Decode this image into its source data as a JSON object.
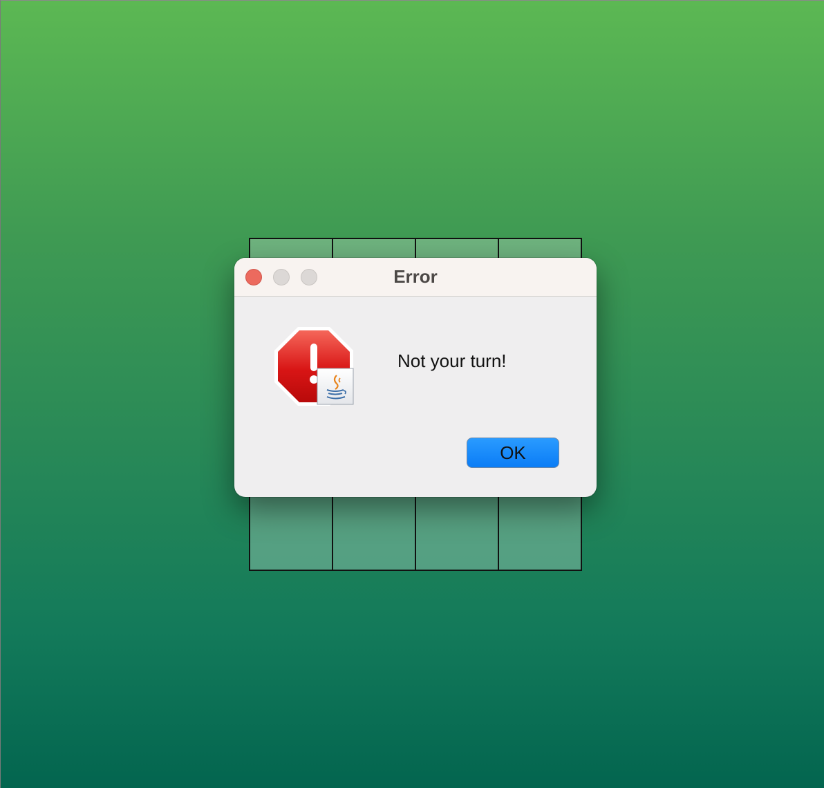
{
  "dialog": {
    "title": "Error",
    "message": "Not your turn!",
    "ok_label": "OK",
    "icon": "stop-error-icon",
    "badge_icon": "java-coffee-cup-icon"
  },
  "board": {
    "rows": 4,
    "columns": 4
  },
  "colors": {
    "background_top": "#5cb853",
    "background_bottom": "#03654f",
    "close_button": "#ec6a5e",
    "ok_button": "#0a7cf6",
    "stop_sign": "#d60f0f"
  }
}
